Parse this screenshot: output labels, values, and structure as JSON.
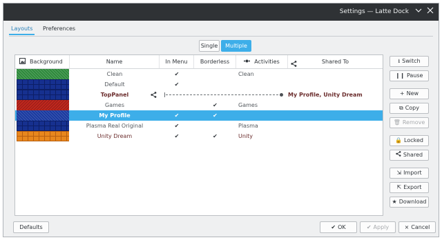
{
  "window": {
    "title": "Settings — Latte Dock"
  },
  "tabs": [
    {
      "label": "Layouts",
      "active": true
    },
    {
      "label": "Preferences",
      "active": false
    }
  ],
  "mode": {
    "single_label": "Single",
    "multiple_label": "Multiple",
    "selected": "Multiple"
  },
  "table": {
    "columns": {
      "background": "Background",
      "name": "Name",
      "in_menu": "In Menu",
      "borderless": "Borderless",
      "activities": "Activities",
      "shared_to": "Shared To"
    },
    "rows": [
      {
        "name": "Clean",
        "in_menu": "✔",
        "borderless": "",
        "activities": "Clean",
        "shared_to": "",
        "background": "green"
      },
      {
        "name": "Default",
        "in_menu": "✔",
        "borderless": "",
        "activities": "",
        "shared_to": "",
        "background": "blue"
      },
      {
        "name": "TopPanel",
        "in_menu": "",
        "borderless": "",
        "activities": "",
        "shared_to": "My Profile, Unity Dream",
        "background": "blue"
      },
      {
        "name": "Games",
        "in_menu": "",
        "borderless": "✔",
        "activities": "Games",
        "shared_to": "",
        "background": "red"
      },
      {
        "name": "My Profile",
        "in_menu": "✔",
        "borderless": "✔",
        "activities": "",
        "shared_to": "",
        "background": "navy"
      },
      {
        "name": "Plasma Real Original",
        "in_menu": "✔",
        "borderless": "",
        "activities": "Plasma",
        "shared_to": "",
        "background": "blue"
      },
      {
        "name": "Unity Dream",
        "in_menu": "✔",
        "borderless": "✔",
        "activities": "Unity",
        "shared_to": "",
        "background": "orange"
      }
    ]
  },
  "side_buttons": {
    "switch": "Switch",
    "pause": "Pause",
    "new": "New",
    "copy": "Copy",
    "remove": "Remove",
    "locked": "Locked",
    "shared": "Shared",
    "import": "Import",
    "export": "Export",
    "download": "Download"
  },
  "footer": {
    "defaults": "Defaults",
    "ok": "OK",
    "apply": "Apply",
    "cancel": "Cancel"
  },
  "icons": {
    "ok": "✔",
    "apply": "✔",
    "cancel": "×",
    "new": "+",
    "pause": "❙❙",
    "download": "★"
  },
  "colors": {
    "accent": "#3daee9",
    "titlebar": "#2f3235"
  }
}
